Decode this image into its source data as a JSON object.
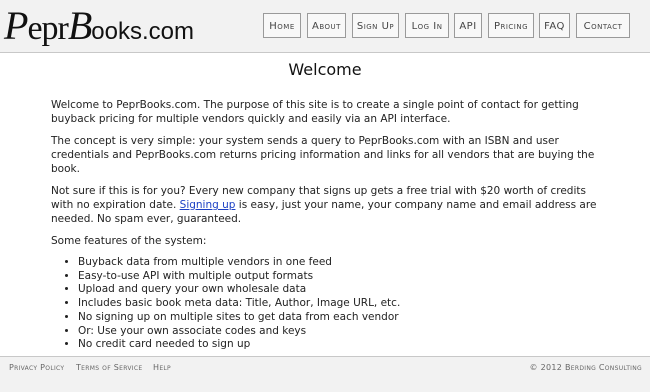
{
  "header": {
    "logo": {
      "first": "P",
      "mid": "epr",
      "second": "B",
      "tail": "ooks.com"
    },
    "nav": [
      "Home",
      "About",
      "Sign Up",
      "Log In",
      "API",
      "Pricing",
      "FAQ",
      "Contact"
    ]
  },
  "main": {
    "title": "Welcome",
    "p1": "Welcome to PeprBooks.com. The purpose of this site is to create a single point of contact for getting buyback pricing for multiple vendors quickly and easily via an API interface.",
    "p2": "The concept is very simple: your system sends a query to PeprBooks.com with an ISBN and user credentials and PeprBooks.com returns pricing information and links for all vendors that are buying the book.",
    "p3_before": "Not sure if this is for you? Every new company that signs up gets a free trial with $20 worth of credits with no expiration date. ",
    "p3_link": "Signing up",
    "p3_after": " is easy, just your name, your company name and email address are needed. No spam ever, guaranteed.",
    "features_intro": "Some features of the system:",
    "features": [
      "Buyback data from multiple vendors in one feed",
      "Easy-to-use API with multiple output formats",
      "Upload and query your own wholesale data",
      "Includes basic book meta data: Title, Author, Image URL, etc.",
      "No signing up on multiple sites to get data from each vendor",
      "Or: Use your own associate codes and keys",
      "No credit card needed to sign up"
    ]
  },
  "footer": {
    "links": [
      "Privacy Policy",
      "Terms of Service",
      "Help"
    ],
    "copyright": "© 2012 Berding Consulting"
  }
}
